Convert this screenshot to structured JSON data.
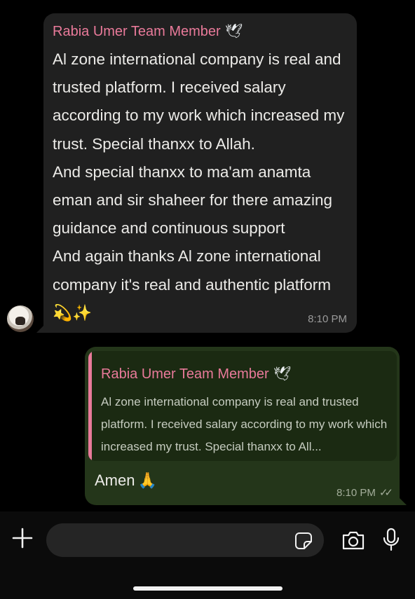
{
  "incoming": {
    "sender": "Rabia Umer Team Member",
    "sender_emoji": "🕊",
    "text": "Al zone international company is real and trusted platform. I received salary according to my work which increased my trust. Special thanxx to Allah.\nAnd special thanxx to ma'am anamta eman and sir shaheer for there amazing guidance and continuous support\nAnd again thanks Al zone international company it's real and authentic platform ",
    "trailing_emoji": "💫✨",
    "time": "8:10 PM"
  },
  "outgoing": {
    "quote": {
      "sender": "Rabia Umer Team Member",
      "sender_emoji": "🕊",
      "text": "Al zone international company is real and trusted platform. I received salary according to my work which increased my trust. Special thanxx to All..."
    },
    "text": "Amen",
    "emoji": "🙏",
    "time": "8:10 PM",
    "status": "read",
    "ticks": "✓✓"
  },
  "composer": {
    "placeholder": "",
    "icons": [
      "plus-icon",
      "sticker-icon",
      "camera-icon",
      "microphone-icon"
    ]
  },
  "colors": {
    "background": "#000000",
    "incoming_bubble": "#202020",
    "outgoing_bubble": "#24361a",
    "sender_name": "#e97a9a"
  }
}
